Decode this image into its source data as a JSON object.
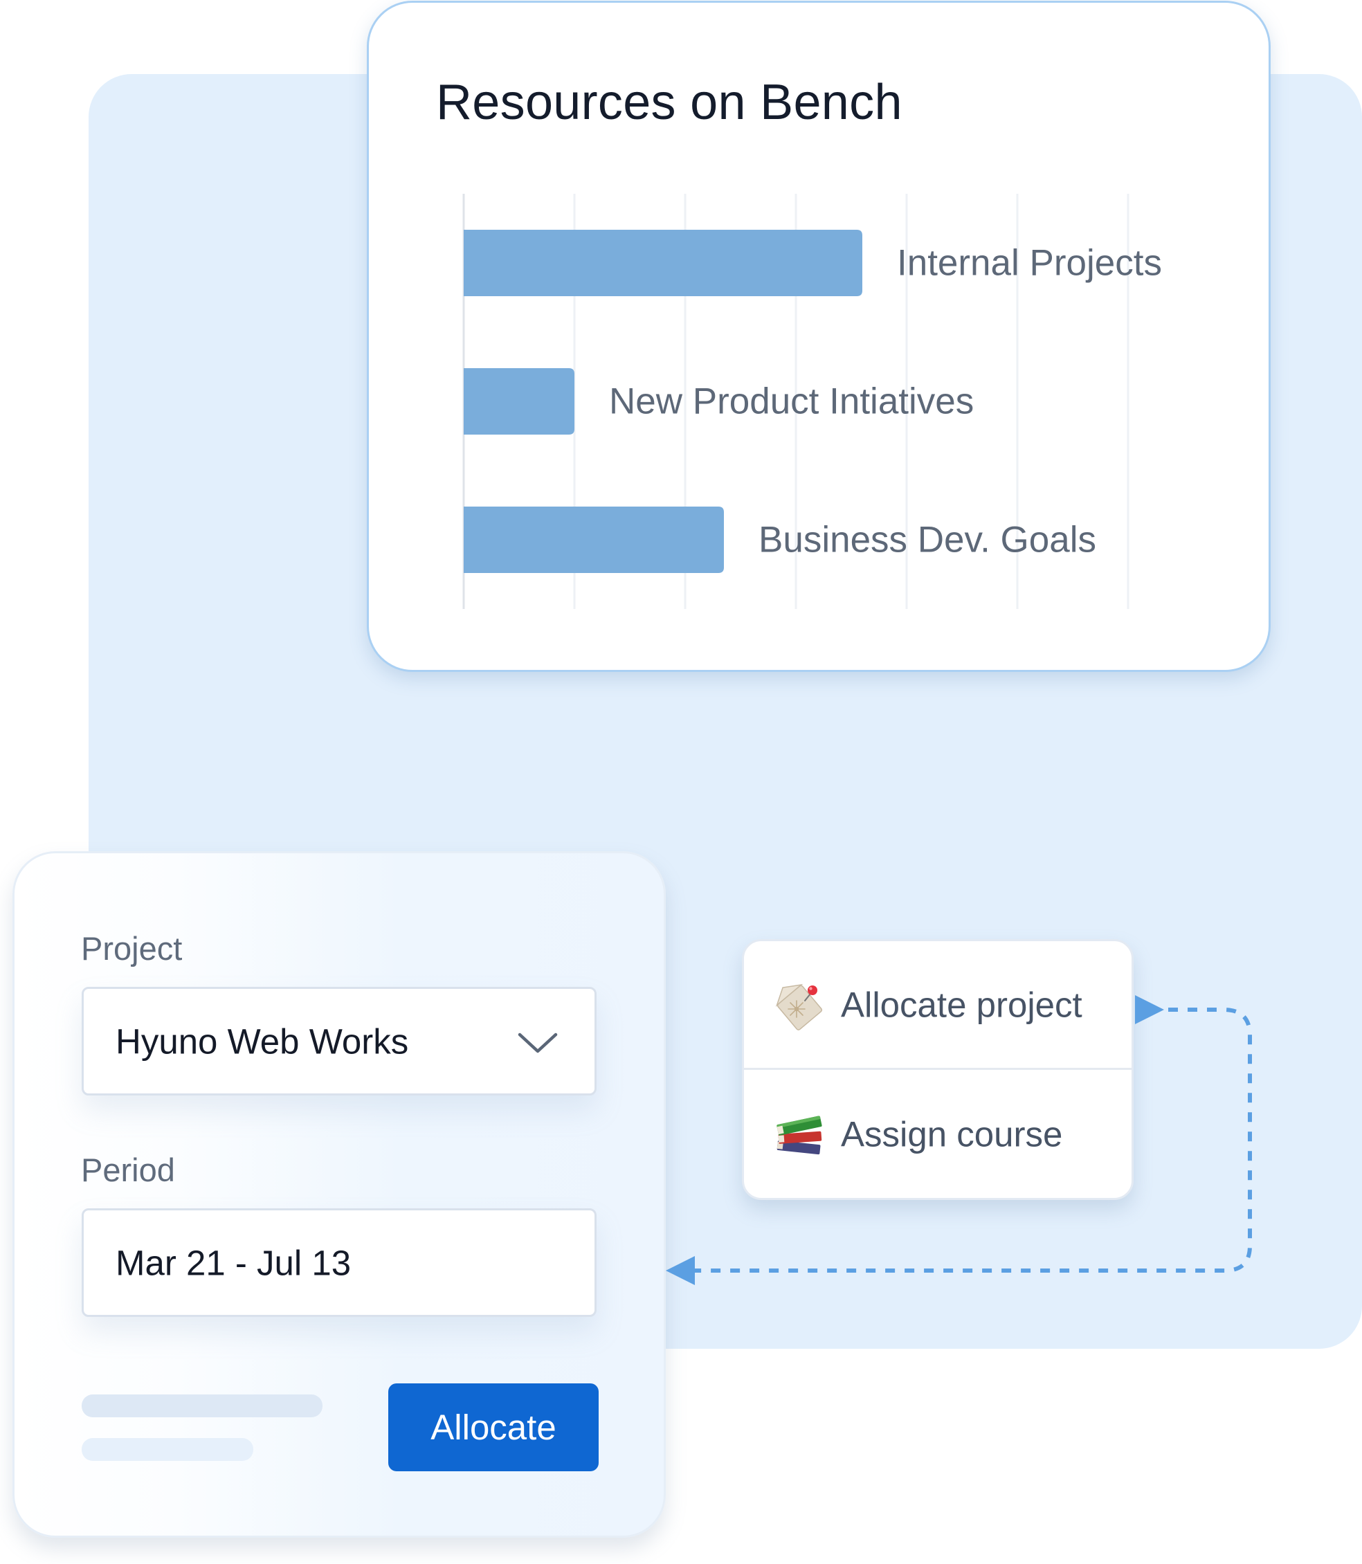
{
  "chart_data": {
    "type": "bar",
    "orientation": "horizontal",
    "title": "Resources on Bench",
    "categories": [
      "Internal Projects",
      "New Product Intiatives",
      "Business Dev. Goals"
    ],
    "values": [
      3.6,
      1.0,
      2.35
    ],
    "xlim": [
      0,
      6
    ],
    "xlabel": "",
    "ylabel": "",
    "grid": true,
    "bar_color": "#7aaddb",
    "label_color": "#5d6878",
    "grid_color": "#eef1f5",
    "axis_color": "#dfe3e9"
  },
  "form": {
    "project_label": "Project",
    "project_value": "Hyuno Web Works",
    "period_label": "Period",
    "period_value": "Mar 21 - Jul 13",
    "allocate_label": "Allocate",
    "dropdown_icon": "chevron-down-icon"
  },
  "actions": {
    "items": [
      {
        "label": "Allocate project",
        "icon": "pinned-tag-icon"
      },
      {
        "label": "Assign course",
        "icon": "books-icon"
      }
    ]
  },
  "colors": {
    "background_panel": "#e2effc",
    "card_border": "#aad0f3",
    "button": "#0f67d2",
    "flow_arrow": "#5b9fe2",
    "skeleton_1": "#dde8f5",
    "skeleton_2": "#e6f0fb"
  }
}
